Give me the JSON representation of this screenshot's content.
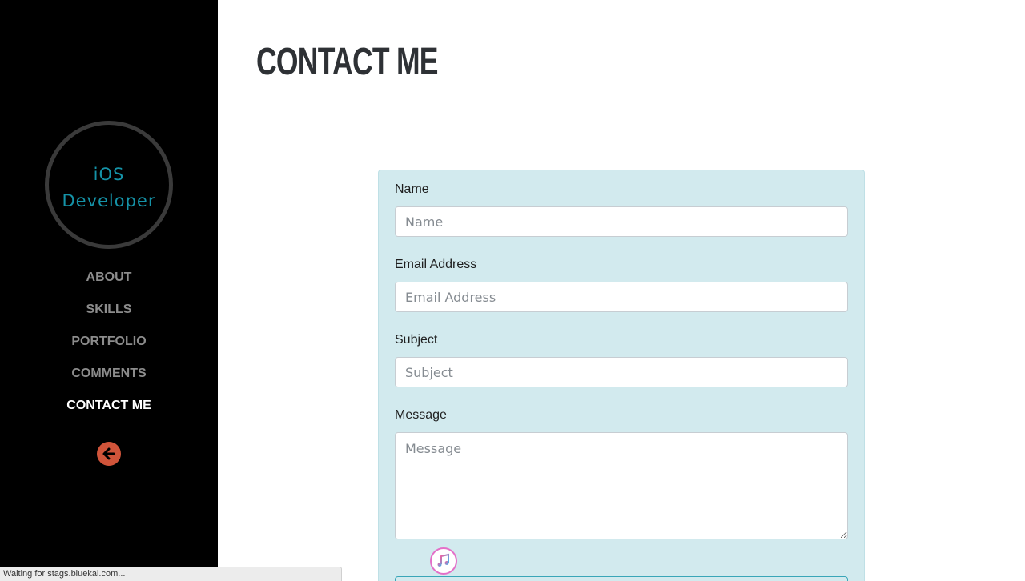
{
  "sidebar": {
    "logo": {
      "line1": "iOS",
      "line2": "Developer"
    },
    "nav": [
      {
        "label": "ABOUT"
      },
      {
        "label": "SKILLS"
      },
      {
        "label": "PORTFOLIO"
      },
      {
        "label": "COMMENTS"
      },
      {
        "label": "CONTACT ME",
        "active": true
      }
    ],
    "back_icon": "arrow-left-circle-icon"
  },
  "main": {
    "title": "CONTACT ME",
    "form": {
      "name": {
        "label": "Name",
        "placeholder": "Name",
        "value": ""
      },
      "email": {
        "label": "Email Address",
        "placeholder": "Email Address",
        "value": ""
      },
      "subject": {
        "label": "Subject",
        "placeholder": "Subject",
        "value": ""
      },
      "message": {
        "label": "Message",
        "placeholder": "Message",
        "value": ""
      }
    },
    "music_icon": "itunes-music-icon"
  },
  "status_bar": {
    "text": "Waiting for stags.bluekai.com..."
  },
  "colors": {
    "sidebar_bg": "#000000",
    "logo_text": "#1593a8",
    "nav_text": "#8c8c8c",
    "nav_active": "#ffffff",
    "back_button": "#d0543a",
    "form_bg": "#d2eaee",
    "title_text": "#2e3135"
  }
}
